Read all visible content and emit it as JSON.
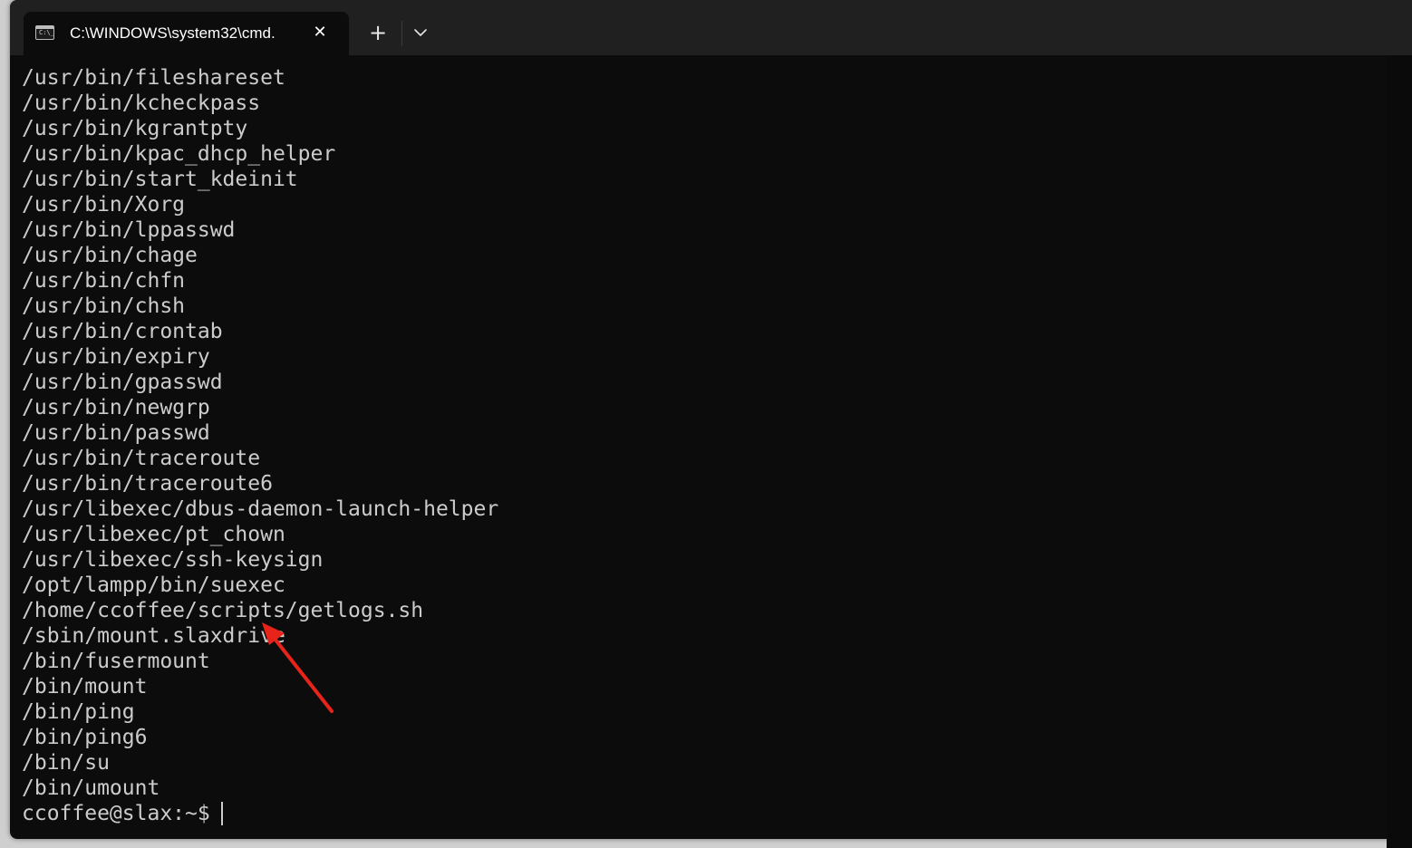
{
  "window": {
    "tab_title": "C:\\WINDOWS\\system32\\cmd.",
    "tab_icon_text": "C:\\_",
    "close_glyph": "✕",
    "new_tab_glyph": "+"
  },
  "terminal": {
    "lines": [
      "/usr/bin/fileshareset",
      "/usr/bin/kcheckpass",
      "/usr/bin/kgrantpty",
      "/usr/bin/kpac_dhcp_helper",
      "/usr/bin/start_kdeinit",
      "/usr/bin/Xorg",
      "/usr/bin/lppasswd",
      "/usr/bin/chage",
      "/usr/bin/chfn",
      "/usr/bin/chsh",
      "/usr/bin/crontab",
      "/usr/bin/expiry",
      "/usr/bin/gpasswd",
      "/usr/bin/newgrp",
      "/usr/bin/passwd",
      "/usr/bin/traceroute",
      "/usr/bin/traceroute6",
      "/usr/libexec/dbus-daemon-launch-helper",
      "/usr/libexec/pt_chown",
      "/usr/libexec/ssh-keysign",
      "/opt/lampp/bin/suexec",
      "/home/ccoffee/scripts/getlogs.sh",
      "/sbin/mount.slaxdrive",
      "/bin/fusermount",
      "/bin/mount",
      "/bin/ping",
      "/bin/ping6",
      "/bin/su",
      "/bin/umount"
    ],
    "prompt": "ccoffee@slax:~$"
  },
  "colors": {
    "terminal_bg": "#0c0c0c",
    "terminal_fg": "#cccccc",
    "titlebar_bg": "#202020",
    "annotation_arrow": "#e8231a"
  },
  "icons": [
    "cmd-app-icon",
    "close-icon",
    "plus-icon",
    "chevron-down-icon",
    "annotation-arrow"
  ]
}
